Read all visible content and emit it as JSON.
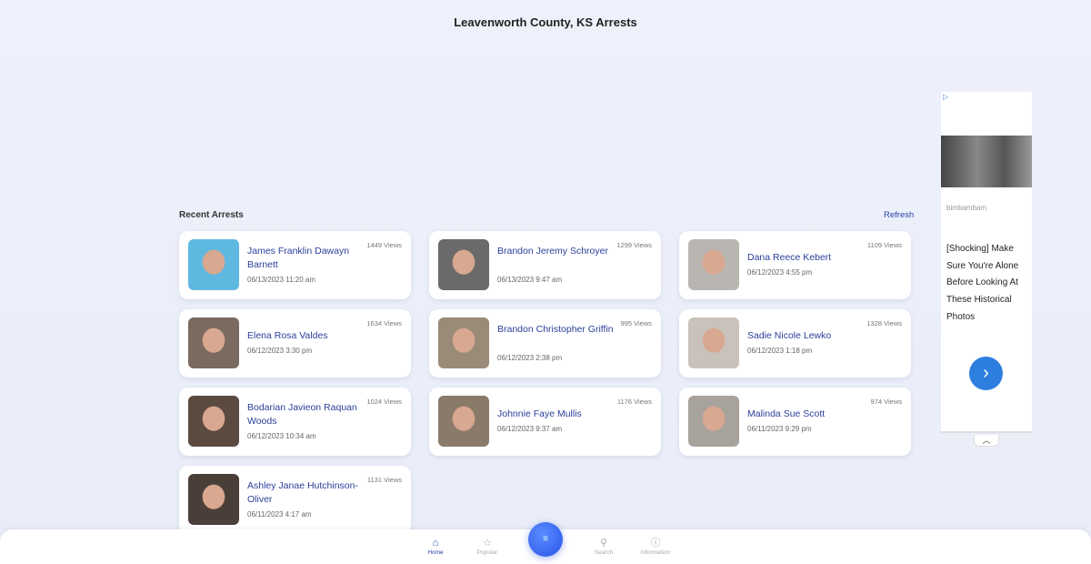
{
  "header": {
    "title": "Leavenworth County, KS Arrests"
  },
  "section": {
    "title": "Recent Arrests",
    "refresh_label": "Refresh"
  },
  "arrests": [
    {
      "name": "James Franklin Dawayn Barnett",
      "date": "06/13/2023 11:20 am",
      "views": "1449 Views",
      "photo_color": "#5fb8e0"
    },
    {
      "name": "Brandon Jeremy Schroyer",
      "date": "06/13/2023 9:47 am",
      "views": "1299 Views",
      "photo_color": "#6a6a6a"
    },
    {
      "name": "Dana Reece Kebert",
      "date": "06/12/2023 4:55 pm",
      "views": "1109 Views",
      "photo_color": "#b9b5b0"
    },
    {
      "name": "Elena Rosa Valdes",
      "date": "06/12/2023 3:30 pm",
      "views": "1634 Views",
      "photo_color": "#7a6a60"
    },
    {
      "name": "Brandon Christopher Griffin",
      "date": "06/12/2023 2:38 pm",
      "views": "995 Views",
      "photo_color": "#9a8a78"
    },
    {
      "name": "Sadie Nicole Lewko",
      "date": "06/12/2023 1:18 pm",
      "views": "1328 Views",
      "photo_color": "#c8c2bb"
    },
    {
      "name": "Bodarian Javieon Raquan Woods",
      "date": "06/12/2023 10:34 am",
      "views": "1024 Views",
      "photo_color": "#5a4a40"
    },
    {
      "name": "Johnnie Faye Mullis",
      "date": "06/12/2023 9:37 am",
      "views": "1176 Views",
      "photo_color": "#8a7a6a"
    },
    {
      "name": "Malinda Sue Scott",
      "date": "06/11/2023 9:29 pm",
      "views": "974 Views",
      "photo_color": "#a8a29c"
    },
    {
      "name": "Ashley Janae Hutchinson-Oliver",
      "date": "06/11/2023 4:17 am",
      "views": "1131 Views",
      "photo_color": "#4a3e38"
    }
  ],
  "ad": {
    "source": "bimbambam",
    "headline": "[Shocking] Make Sure You're Alone Before Looking At These Historical Photos"
  },
  "nav": [
    {
      "label": "Home",
      "icon": "home-icon",
      "active": true
    },
    {
      "label": "Popular",
      "icon": "star-icon"
    },
    {
      "label": "Search",
      "icon": "search-icon"
    },
    {
      "label": "Information",
      "icon": "info-icon"
    }
  ],
  "colors": {
    "accent": "#2a45a8",
    "fab": "#3a66f0"
  }
}
